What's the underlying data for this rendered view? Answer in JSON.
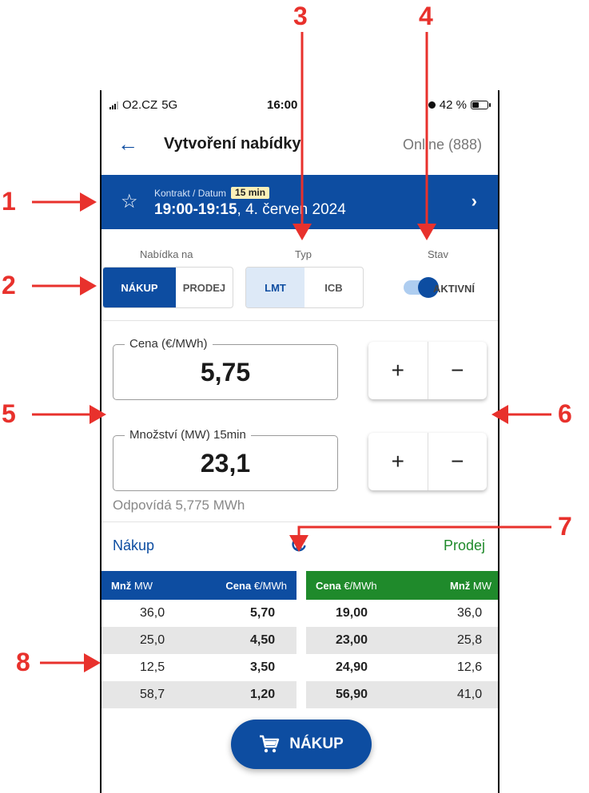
{
  "status_bar": {
    "carrier": "O2.CZ",
    "network": "5G",
    "time": "16:00",
    "battery": "42 %"
  },
  "app_bar": {
    "back_icon": "arrow-left-icon",
    "title": "Vytvoření nabídky",
    "online": "Online (888)"
  },
  "contract": {
    "label": "Kontrakt / Datum",
    "badge": "15 min",
    "time_range": "19:00-19:15",
    "date": ", 4. červen 2024"
  },
  "offer_type": {
    "label": "Nabídka na",
    "options": [
      "NÁKUP",
      "PRODEJ"
    ],
    "selected": "NÁKUP"
  },
  "type": {
    "label": "Typ",
    "options": [
      "LMT",
      "ICB"
    ],
    "selected": "LMT"
  },
  "state": {
    "label": "Stav",
    "value": "AKTIVNÍ",
    "toggle_on": true
  },
  "price": {
    "label": "Cena (€/MWh)",
    "value": "5,75",
    "plus": "+",
    "minus": "−"
  },
  "quantity": {
    "label": "Množství (MW) 15min",
    "value": "23,1",
    "plus": "+",
    "minus": "−"
  },
  "hint": "Odpovídá 5,775 MWh",
  "orderbook": {
    "buy_label": "Nákup",
    "sell_label": "Prodej",
    "buy_header": {
      "qty_bold": "Mnž",
      "qty_unit": " MW",
      "price_bold": "Cena",
      "price_unit": " €/MWh"
    },
    "sell_header": {
      "price_bold": "Cena",
      "price_unit": " €/MWh",
      "qty_bold": "Mnž",
      "qty_unit": " MW"
    },
    "rows": [
      {
        "buy_qty": "36,0",
        "buy_price": "5,70",
        "sell_price": "19,00",
        "sell_qty": "36,0"
      },
      {
        "buy_qty": "25,0",
        "buy_price": "4,50",
        "sell_price": "23,00",
        "sell_qty": "25,8"
      },
      {
        "buy_qty": "12,5",
        "buy_price": "3,50",
        "sell_price": "24,90",
        "sell_qty": "12,6"
      },
      {
        "buy_qty": "58,7",
        "buy_price": "1,20",
        "sell_price": "56,90",
        "sell_qty": "41,0"
      }
    ]
  },
  "fab": {
    "label": "NÁKUP",
    "icon": "cart-icon"
  },
  "annotations": [
    "1",
    "2",
    "3",
    "4",
    "5",
    "6",
    "7",
    "8"
  ],
  "colors": {
    "primary": "#0d4da1",
    "buy": "#0d4da1",
    "sell": "#1f8a2b",
    "annotation": "#e8312c"
  }
}
